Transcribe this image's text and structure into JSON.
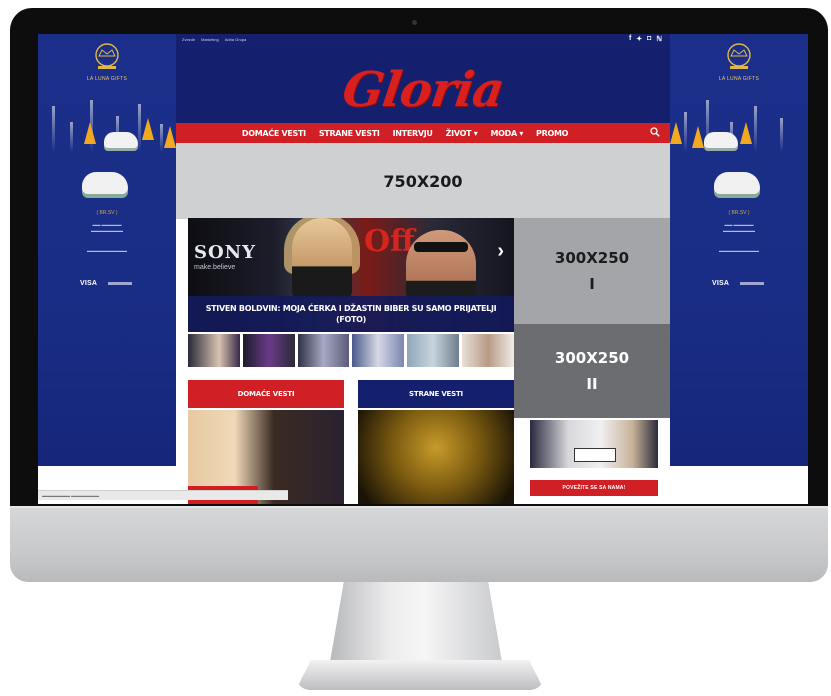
{
  "site": {
    "logo": "Gloria",
    "top_links": [
      "Zvezde",
      "Marketing",
      "Adria Grupa"
    ],
    "social_icons": [
      "facebook-icon",
      "twitter-icon",
      "instagram-icon",
      "rss-icon"
    ]
  },
  "nav": {
    "items": [
      "DOMAĆE VESTI",
      "STRANE VESTI",
      "INTERVJU",
      "ŽIVOT ▾",
      "MODA ▾",
      "PROMO"
    ]
  },
  "ads": {
    "leaderboard": "750X200",
    "rect_one": "300X250\nI",
    "rect_two": "300X250\nII"
  },
  "slider": {
    "caption": "STIVEN BOLDVIN: MOJA ĆERKA I DŽASTIN BIBER SU SAMO PRIJATELJI (FOTO)",
    "brand_text": "SONY",
    "brand_sub": "make.believe",
    "overlay_text": "Off",
    "arrow": "›"
  },
  "sections": {
    "domestic": "DOMAĆE VESTI",
    "foreign": "STRANE VESTI"
  },
  "sidebar": {
    "connect_label": "POVEŽITE SE SA NAMA!"
  },
  "skin": {
    "brand_top": "LA LUNA GIFTS",
    "line_a": "( BR.SV )",
    "visa": "VISA"
  },
  "colors": {
    "navy": "#14206e",
    "red": "#d01f25",
    "skin_blue": "#1b2f8a"
  }
}
